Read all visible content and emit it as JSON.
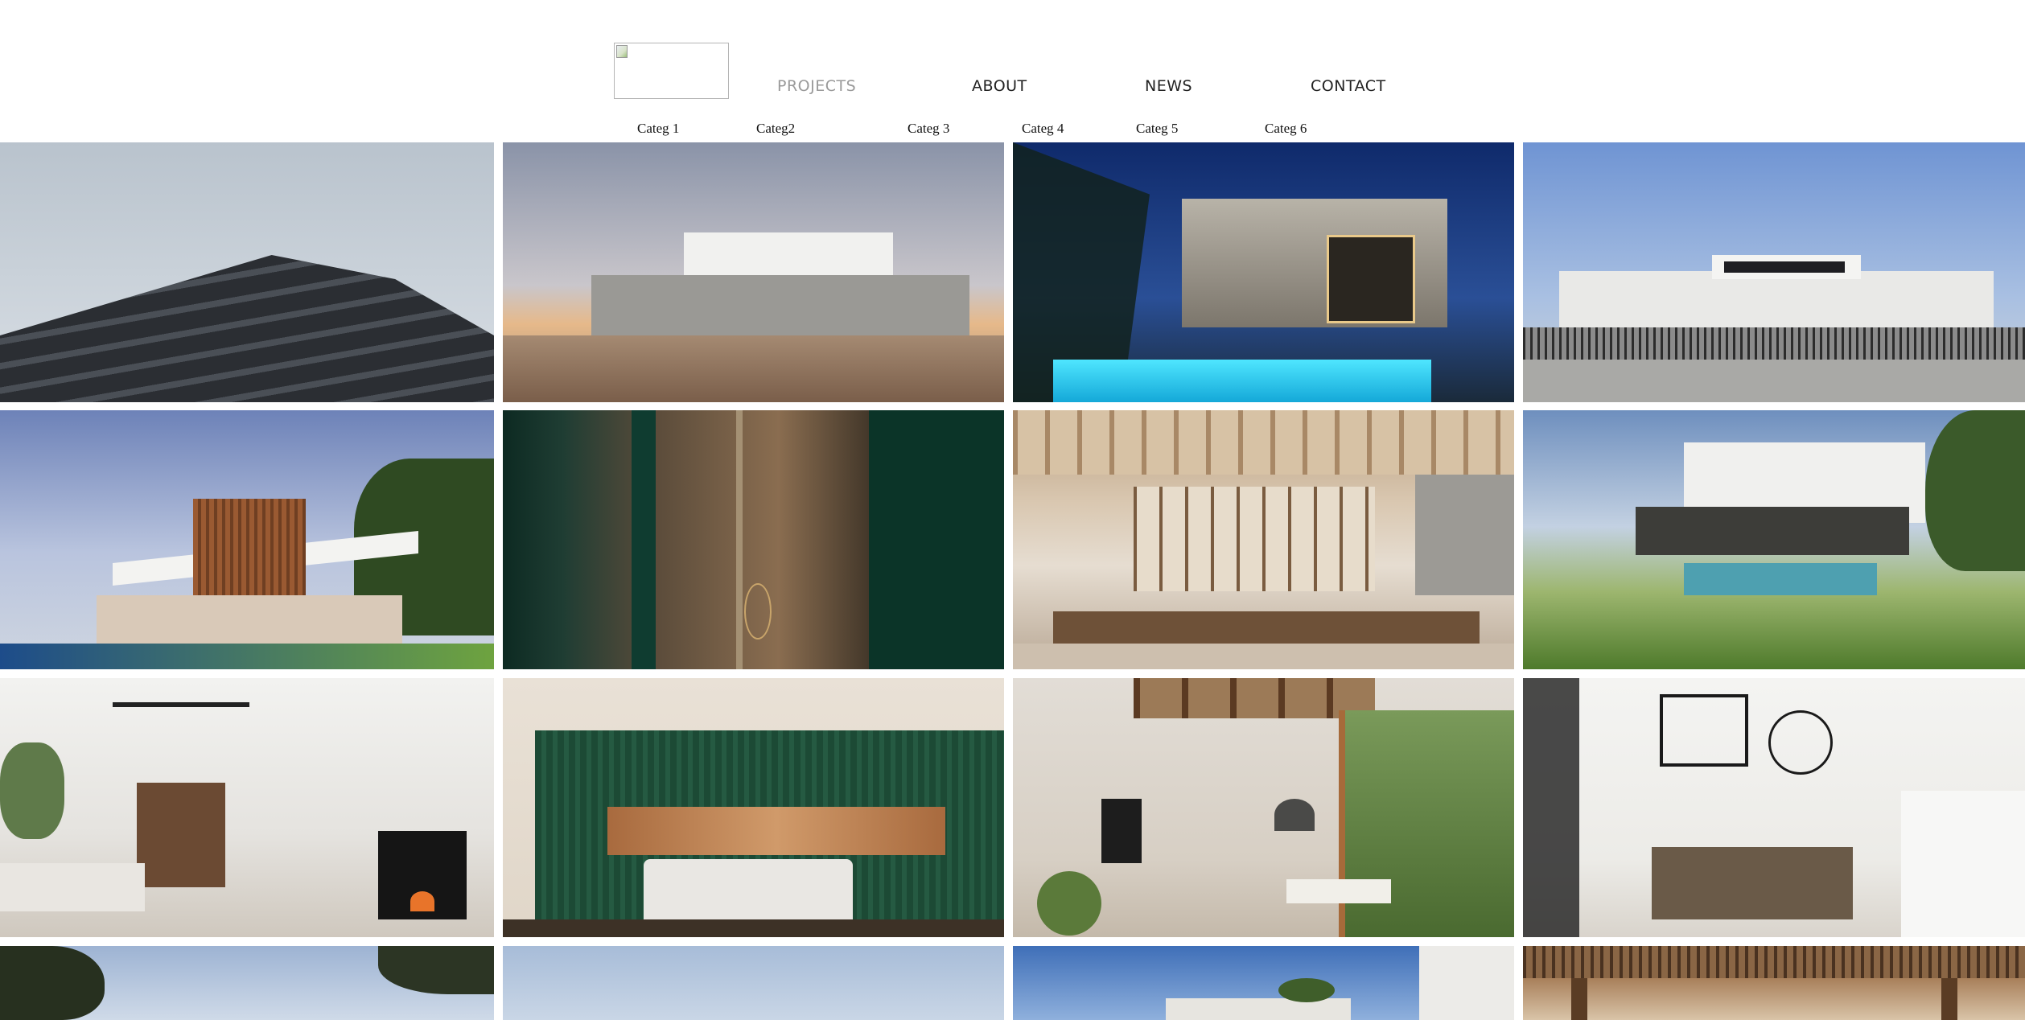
{
  "header": {
    "logo_icon": "broken-image-icon",
    "nav": [
      {
        "label": "PROJECTS",
        "active": true
      },
      {
        "label": "ABOUT",
        "active": false
      },
      {
        "label": "NEWS",
        "active": false
      },
      {
        "label": "CONTACT",
        "active": false
      }
    ],
    "nav_colors": {
      "active": "#9a9a9a",
      "default": "#222222"
    }
  },
  "categories": [
    "Categ 1",
    "Categ2",
    "Categ 3",
    "Categ 4",
    "Categ 5",
    "Categ 6"
  ],
  "grid": {
    "columns": 4,
    "tiles": [
      {
        "subject": "dark-striped-facade-building"
      },
      {
        "subject": "concrete-house-at-dusk"
      },
      {
        "subject": "night-villa-with-pool"
      },
      {
        "subject": "white-modern-house-street"
      },
      {
        "subject": "cantilevered-white-villa"
      },
      {
        "subject": "green-glass-door-reflection"
      },
      {
        "subject": "wooden-ceiling-restaurant"
      },
      {
        "subject": "white-villa-pool-lawn"
      },
      {
        "subject": "living-room-ceiling-fan"
      },
      {
        "subject": "green-panel-bedroom"
      },
      {
        "subject": "lounge-hanging-fireplace"
      },
      {
        "subject": "double-height-white-interior"
      },
      {
        "subject": "tree-silhouette-sky"
      },
      {
        "subject": "pale-blue-sky"
      },
      {
        "subject": "house-under-blue-sky"
      },
      {
        "subject": "wooden-pergola-terrace"
      }
    ]
  }
}
